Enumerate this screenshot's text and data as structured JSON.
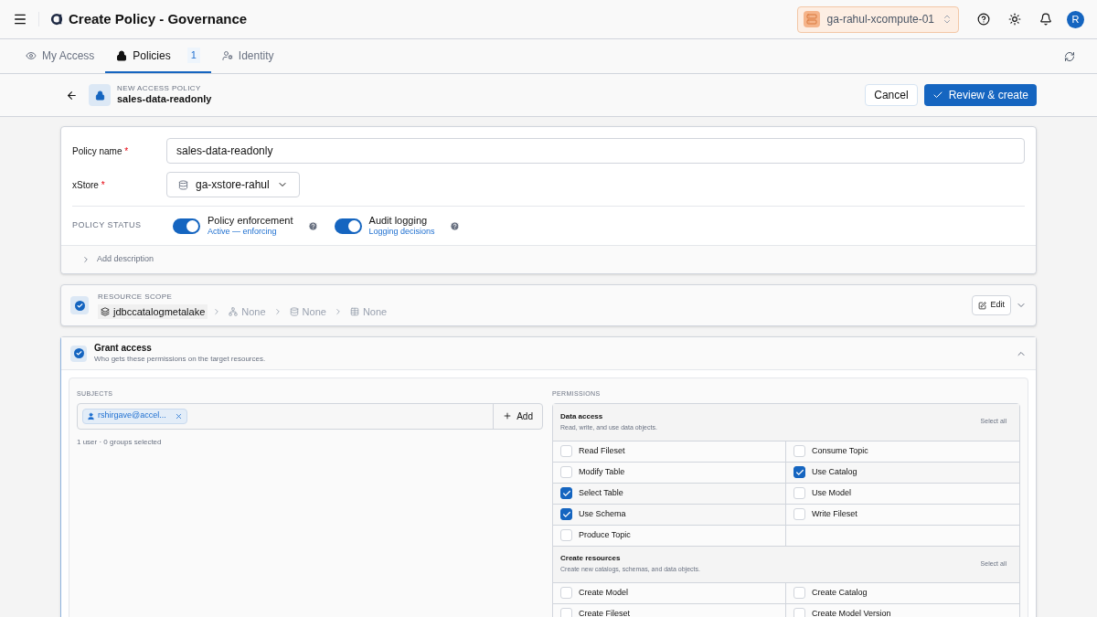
{
  "header": {
    "title": "Create Policy - Governance",
    "workspace": "ga-rahul-xcompute-01",
    "avatar": "R"
  },
  "tabs": [
    {
      "label": "My Access",
      "selected": false
    },
    {
      "label": "Policies",
      "selected": true,
      "count": "1"
    },
    {
      "label": "Identity",
      "selected": false
    }
  ],
  "page": {
    "eyebrow": "NEW ACCESS POLICY",
    "title": "sales-data-readonly",
    "cancel": "Cancel",
    "submit": "Review & create"
  },
  "form": {
    "name_label": "Policy name",
    "name_value": "sales-data-readonly",
    "store_label": "xStore",
    "store_value": "ga-xstore-rahul",
    "required_mark": "*",
    "status_label": "POLICY STATUS",
    "toggles": [
      {
        "label": "Policy enforcement",
        "sub": "Active — enforcing",
        "on": true
      },
      {
        "label": "Audit logging",
        "sub": "Logging decisions",
        "on": true
      }
    ],
    "add_description": "Add description"
  },
  "scope": {
    "eyebrow": "RESOURCE SCOPE",
    "done": true,
    "path": [
      {
        "label": "jdbccatalogmetalake",
        "set": true
      },
      {
        "label": "None",
        "set": false
      },
      {
        "label": "None",
        "set": false
      },
      {
        "label": "None",
        "set": false
      }
    ],
    "edit": "Edit",
    "expanded": false
  },
  "grant": {
    "title": "Grant access",
    "subtitle": "Who gets these permissions on the target resources.",
    "done": true,
    "expanded": true,
    "subjects_label": "SUBJECTS",
    "chips": [
      "rshirgave@accel..."
    ],
    "add": "Add",
    "summary": "1 user · 0 groups selected",
    "permissions_label": "PERMISSIONS",
    "groups": [
      {
        "title": "Data access",
        "subtitle": "Read, write, and use data objects.",
        "select_all": "Select all",
        "items": [
          {
            "label": "Read Fileset",
            "checked": false
          },
          {
            "label": "Consume Topic",
            "checked": false
          },
          {
            "label": "Modify Table",
            "checked": false
          },
          {
            "label": "Use Catalog",
            "checked": true
          },
          {
            "label": "Select Table",
            "checked": true
          },
          {
            "label": "Use Model",
            "checked": false
          },
          {
            "label": "Use Schema",
            "checked": true
          },
          {
            "label": "Write Fileset",
            "checked": false
          },
          {
            "label": "Produce Topic",
            "checked": false
          }
        ]
      },
      {
        "title": "Create resources",
        "subtitle": "Create new catalogs, schemas, and data objects.",
        "select_all": "Select all",
        "items": [
          {
            "label": "Create Model",
            "checked": false
          },
          {
            "label": "Create Catalog",
            "checked": false
          },
          {
            "label": "Create Fileset",
            "checked": false
          },
          {
            "label": "Create Model Version",
            "checked": false
          }
        ]
      }
    ]
  }
}
